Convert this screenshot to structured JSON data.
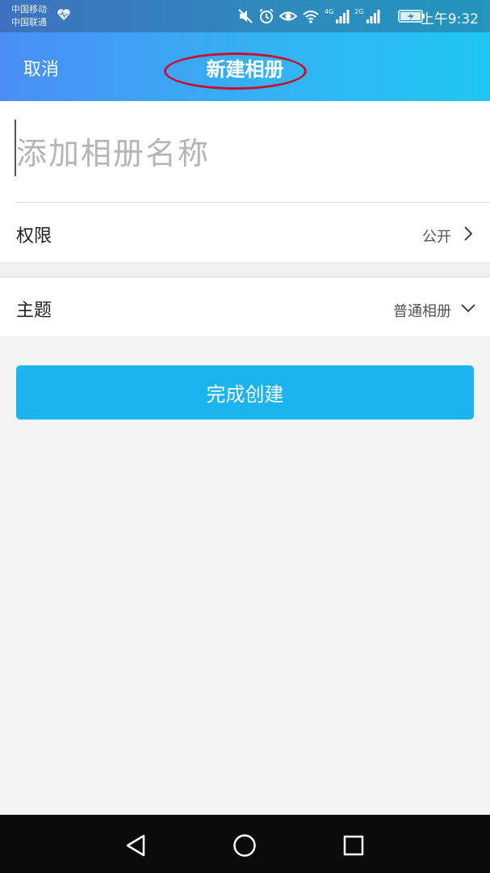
{
  "status_bar": {
    "carrier_1": "中国移动",
    "carrier_2": "中国联通",
    "network_1": "4G",
    "network_2": "2G",
    "time": "上午9:32",
    "icons": [
      "heart-pulse-icon",
      "mute-icon",
      "alarm-icon",
      "eye-icon",
      "wifi-icon",
      "signal-icon",
      "signal-icon",
      "battery-charging-icon"
    ]
  },
  "nav": {
    "cancel_label": "取消",
    "title": "新建相册"
  },
  "form": {
    "album_name_placeholder": "添加相册名称",
    "album_name_value": "",
    "permission_label": "权限",
    "permission_value": "公开",
    "theme_label": "主题",
    "theme_value": "普通相册"
  },
  "actions": {
    "create_label": "完成创建"
  },
  "colors": {
    "header_gradient_start": "#4a8ef5",
    "header_gradient_end": "#1fc6f4",
    "button": "#1cb4ee",
    "highlight_ellipse": "#c8102e"
  },
  "system_nav": {
    "icons": [
      "back-icon",
      "home-icon",
      "recents-icon"
    ]
  }
}
